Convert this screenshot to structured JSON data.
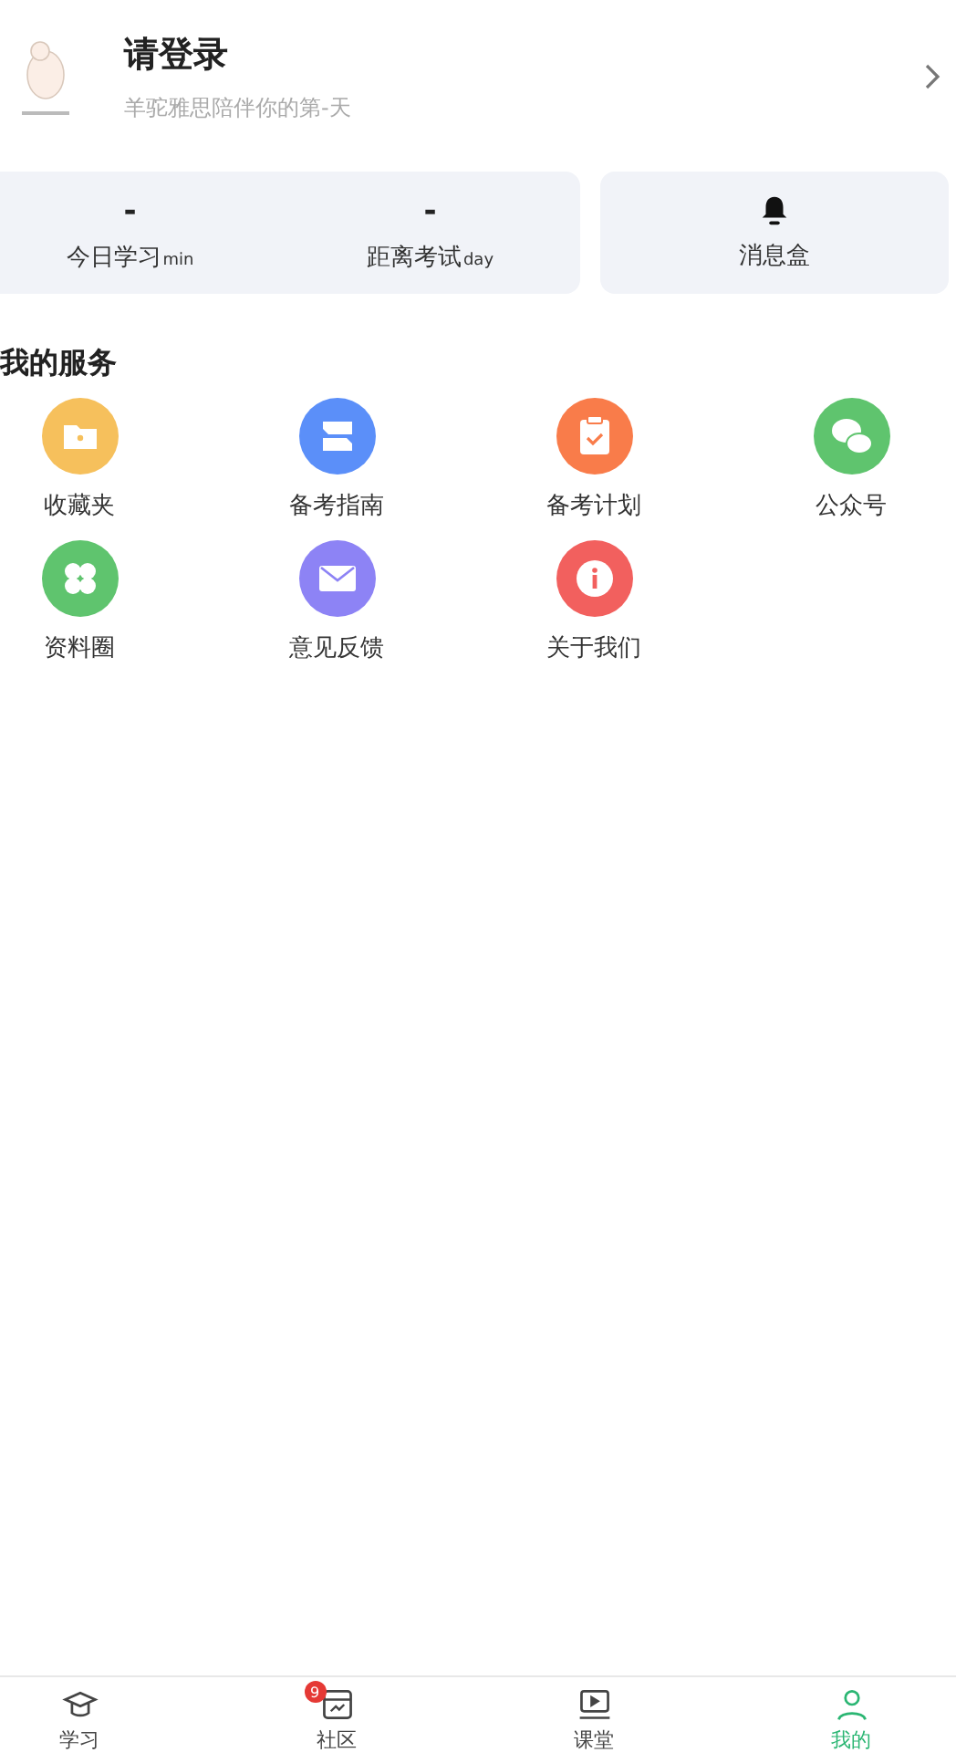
{
  "profile": {
    "title": "请登录",
    "subtitle": "羊驼雅思陪伴你的第-天"
  },
  "stats": [
    {
      "value": "-",
      "label": "今日学习",
      "unit": "min"
    },
    {
      "value": "-",
      "label": "距离考试",
      "unit": "day"
    }
  ],
  "inbox": {
    "label": "消息盒"
  },
  "services": {
    "title": "我的服务",
    "items": [
      {
        "label": "收藏夹",
        "kind": "folder",
        "color": "#f6c05c"
      },
      {
        "label": "备考指南",
        "kind": "guide",
        "color": "#5b8ff9"
      },
      {
        "label": "备考计划",
        "kind": "plan",
        "color": "#f97c4a"
      },
      {
        "label": "公众号",
        "kind": "chat",
        "color": "#5fc46e"
      },
      {
        "label": "资料圈",
        "kind": "clover",
        "color": "#5fc46e"
      },
      {
        "label": "意见反馈",
        "kind": "mail",
        "color": "#8d83f5"
      },
      {
        "label": "关于我们",
        "kind": "info",
        "color": "#f2605e"
      }
    ]
  },
  "tabs": [
    {
      "label": "学习",
      "kind": "cap",
      "selected": false
    },
    {
      "label": "社区",
      "kind": "board",
      "selected": false,
      "badge": "9"
    },
    {
      "label": "课堂",
      "kind": "play",
      "selected": false
    },
    {
      "label": "我的",
      "kind": "user",
      "selected": true
    }
  ]
}
